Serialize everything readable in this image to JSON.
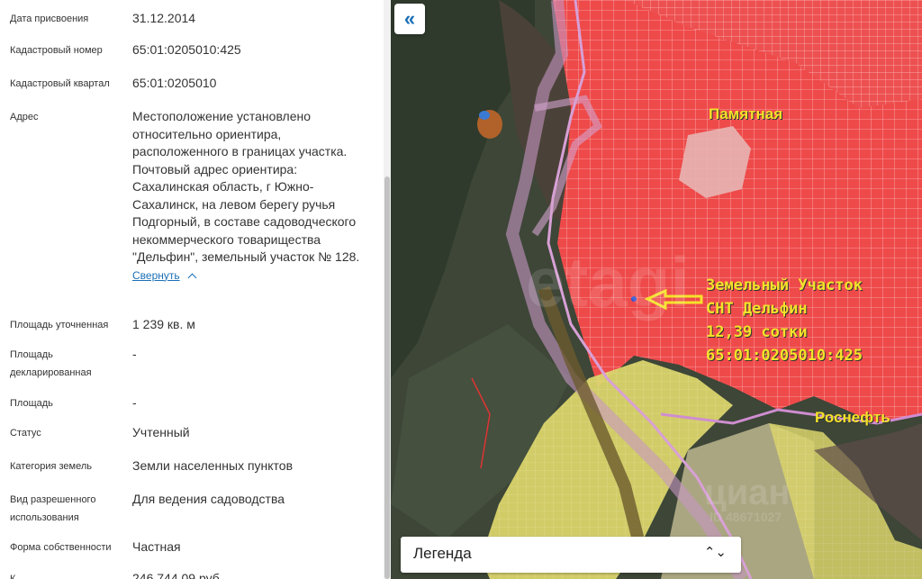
{
  "details": [
    {
      "label": "Дата присвоения",
      "value": "31.12.2014"
    },
    {
      "label": "Кадастровый номер",
      "value": "65:01:0205010:425"
    },
    {
      "label": "Кадастровый квартал",
      "value": "65:01:0205010"
    },
    {
      "label": "Адрес",
      "value": "Местоположение установлено относительно ориентира, расположенного в границах участка. Почтовый адрес ориентира: Сахалинская область, г Южно-Сахалинск, на левом берегу ручья Подгорный, в составе садоводческого некоммерческого товарищества \"Дельфин\", земельный участок № 128."
    },
    {
      "label": "Площадь уточненная",
      "value": "1 239 кв. м"
    },
    {
      "label": "Площадь декларированная",
      "value": "-"
    },
    {
      "label": "Площадь",
      "value": "-"
    },
    {
      "label": "Статус",
      "value": "Учтенный"
    },
    {
      "label": "Категория земель",
      "value": "Земли населенных пунктов"
    },
    {
      "label": "Вид разрешенного использования",
      "value": "Для ведения садоводства"
    },
    {
      "label": "Форма собственности",
      "value": "Частная"
    },
    {
      "label": "К",
      "value": "246 744,09 руб."
    }
  ],
  "address_toggle": "Свернуть",
  "map": {
    "collapse_icon": "double-chevron-left-icon",
    "labels": {
      "pamyatnaya": "Памятная",
      "plot_line1": "Земельный Участок",
      "plot_line2": "СНТ Дельфин",
      "plot_line3": "12,39 сотки",
      "plot_line4": "65:01:0205010:425",
      "rosneft": "Роснефть"
    },
    "watermark_center": "etagi",
    "watermark_bottom": "циан",
    "watermark_id": "ID 48671027",
    "legend_label": "Легенда",
    "legend_icon": "up-down-chevron-icon",
    "colors": {
      "plots": "#ee4a4a",
      "zone": "#d9d36a",
      "outline": "#d48ad0",
      "label": "#f5e22a"
    }
  }
}
